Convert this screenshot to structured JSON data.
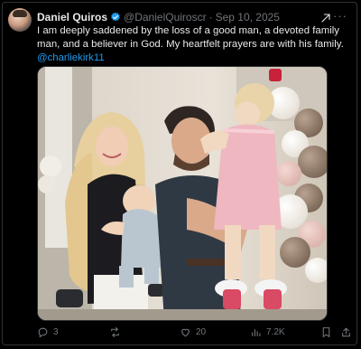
{
  "post": {
    "author": {
      "name": "Daniel Quiros",
      "handle": "@DanielQuiroscr",
      "date": "Sep 10, 2025"
    },
    "text": "I am deeply saddened by the loss of a good man, a devoted family man, and a believer in God. My heartfelt prayers are with his family.",
    "mention": "@charliekirk11",
    "image": {
      "subject": "family photo in front of balloons"
    }
  },
  "actions": {
    "replies": "3",
    "reposts": "",
    "likes": "20",
    "views": "7.2K"
  },
  "icons": {
    "verified": "verified-badge-icon",
    "grok": "grok-icon",
    "more": "more-icon",
    "reply": "reply-icon",
    "repost": "repost-icon",
    "like": "heart-icon",
    "views": "views-icon",
    "bookmark": "bookmark-icon",
    "share": "share-icon"
  },
  "colors": {
    "background": "#000000",
    "text": "#e7e9ea",
    "muted": "#71767b",
    "accent": "#1d9bf0",
    "border": "#2f3336"
  }
}
